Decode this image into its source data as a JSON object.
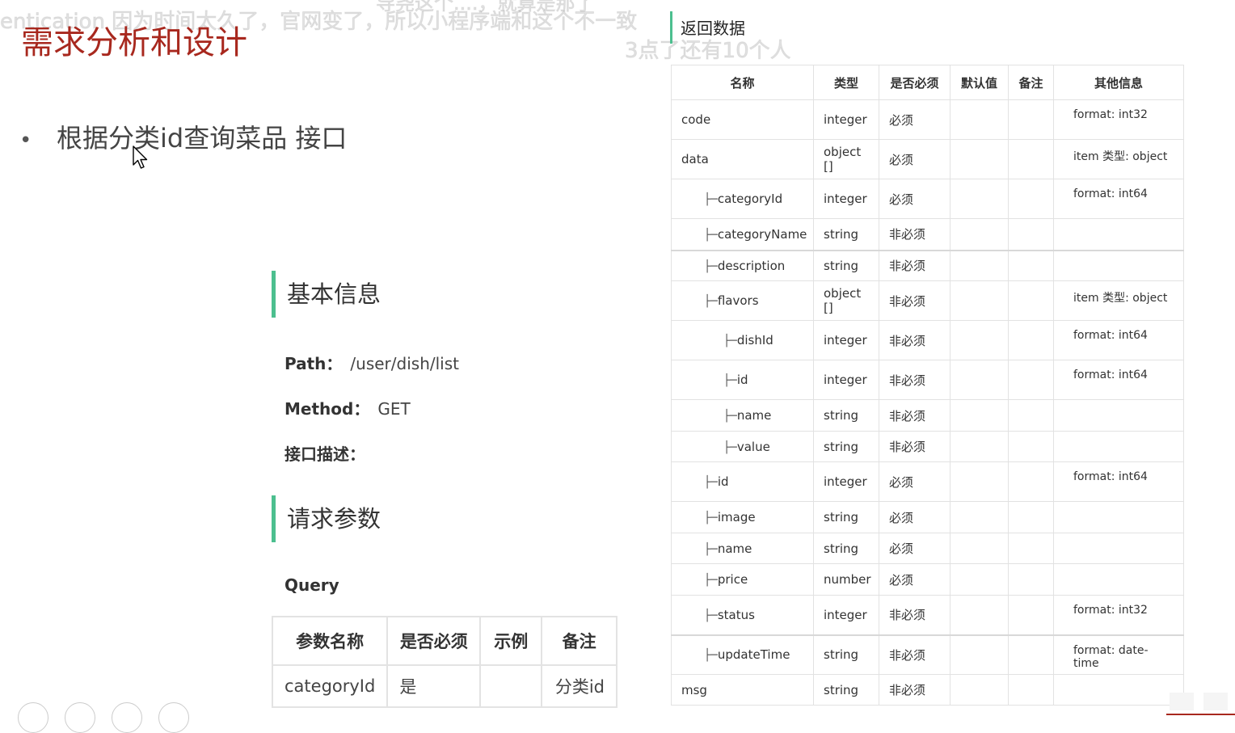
{
  "danmaku": [
    "entication 因为时间太久了，官网变了，所以小程序端和这个不一致",
    "导尧这个....，就算是那了",
    "3点了还有10个人"
  ],
  "slide": {
    "title": "需求分析和设计",
    "bullet": "根据分类id查询菜品 接口"
  },
  "basic": {
    "heading": "基本信息",
    "path_label": "Path：",
    "path_value": "/user/dish/list",
    "method_label": "Method：",
    "method_value": "GET",
    "desc_label": "接口描述："
  },
  "request": {
    "heading": "请求参数",
    "query_label": "Query",
    "columns": [
      "参数名称",
      "是否必须",
      "示例",
      "备注"
    ],
    "rows": [
      [
        "categoryId",
        "是",
        "",
        "分类id"
      ]
    ]
  },
  "response": {
    "heading": "返回数据",
    "columns": [
      "名称",
      "类型",
      "是否必须",
      "默认值",
      "备注",
      "其他信息"
    ],
    "rows": [
      {
        "indent": 0,
        "name": "code",
        "type": "integer",
        "required": "必须",
        "default": "",
        "note": "",
        "other": "format: int32",
        "h": 49
      },
      {
        "indent": 0,
        "name": "data",
        "type": "object []",
        "required": "必须",
        "default": "",
        "note": "",
        "other": "item 类型: object",
        "h": 49
      },
      {
        "indent": 1,
        "name": "categoryId",
        "type": "integer",
        "required": "必须",
        "default": "",
        "note": "",
        "other": "format: int64",
        "h": 49
      },
      {
        "indent": 1,
        "name": "categoryName",
        "type": "string",
        "required": "非必须",
        "default": "",
        "note": "",
        "other": "",
        "h": 39
      },
      {
        "indent": 1,
        "name": "description",
        "type": "string",
        "required": "非必须",
        "default": "",
        "note": "",
        "other": "",
        "h": 38
      },
      {
        "indent": 1,
        "name": "flavors",
        "type": "object []",
        "required": "非必须",
        "default": "",
        "note": "",
        "other": "item 类型: object",
        "h": 49
      },
      {
        "indent": 2,
        "name": "dishId",
        "type": "integer",
        "required": "非必须",
        "default": "",
        "note": "",
        "other": "format: int64",
        "h": 49
      },
      {
        "indent": 2,
        "name": "id",
        "type": "integer",
        "required": "非必须",
        "default": "",
        "note": "",
        "other": "format: int64",
        "h": 49
      },
      {
        "indent": 2,
        "name": "name",
        "type": "string",
        "required": "非必须",
        "default": "",
        "note": "",
        "other": "",
        "h": 39
      },
      {
        "indent": 2,
        "name": "value",
        "type": "string",
        "required": "非必须",
        "default": "",
        "note": "",
        "other": "",
        "h": 38
      },
      {
        "indent": 1,
        "name": "id",
        "type": "integer",
        "required": "必须",
        "default": "",
        "note": "",
        "other": "format: int64",
        "h": 49
      },
      {
        "indent": 1,
        "name": "image",
        "type": "string",
        "required": "必须",
        "default": "",
        "note": "",
        "other": "",
        "h": 39
      },
      {
        "indent": 1,
        "name": "name",
        "type": "string",
        "required": "必须",
        "default": "",
        "note": "",
        "other": "",
        "h": 38
      },
      {
        "indent": 1,
        "name": "price",
        "type": "number",
        "required": "必须",
        "default": "",
        "note": "",
        "other": "",
        "h": 39
      },
      {
        "indent": 1,
        "name": "status",
        "type": "integer",
        "required": "非必须",
        "default": "",
        "note": "",
        "other": "format: int32",
        "h": 49
      },
      {
        "indent": 1,
        "name": "updateTime",
        "type": "string",
        "required": "非必须",
        "default": "",
        "note": "",
        "other": "format: date-time",
        "h": 49
      },
      {
        "indent": 0,
        "name": "msg",
        "type": "string",
        "required": "非必须",
        "default": "",
        "note": "",
        "other": "",
        "h": 38
      }
    ]
  },
  "colors": {
    "title_red": "#a8281e",
    "accent_green": "#4cbf8f"
  }
}
